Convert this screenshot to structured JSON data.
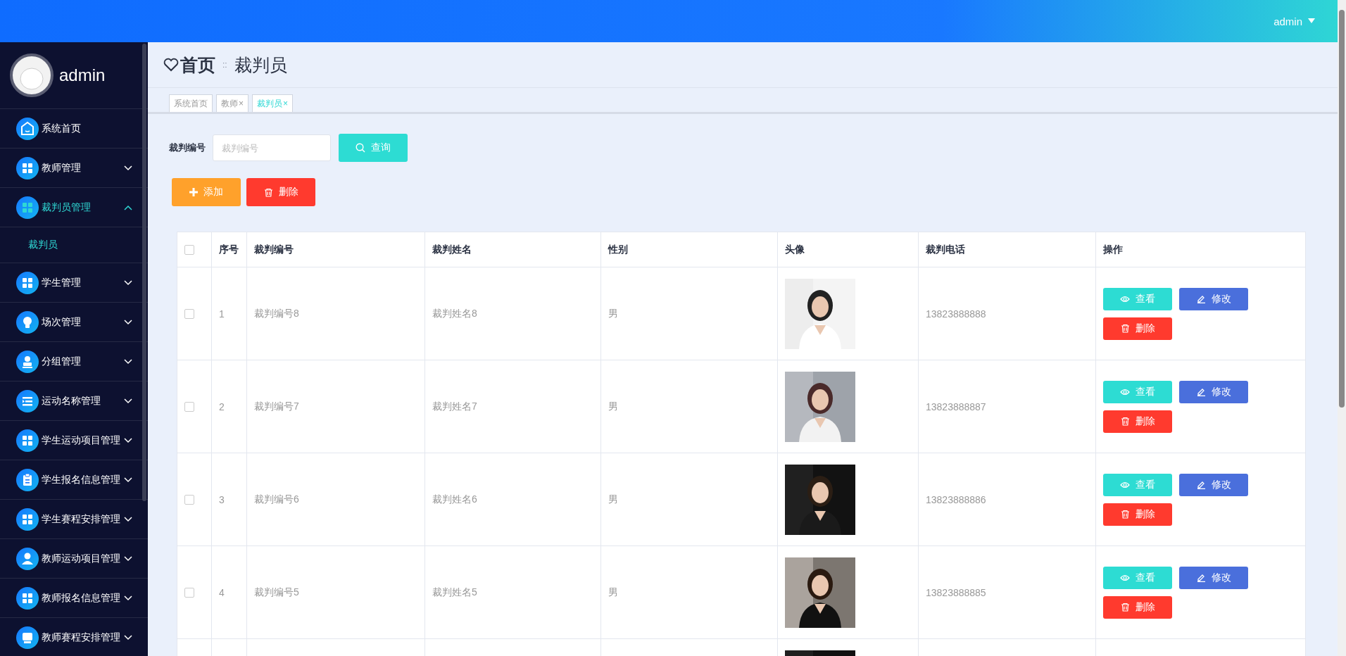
{
  "header": {
    "user": "admin"
  },
  "sidebar": {
    "user": "admin",
    "items": [
      {
        "label": "系统首页",
        "kind": "home",
        "selected": false
      },
      {
        "label": "教师管理",
        "kind": "grid",
        "expanded": false,
        "selected": false
      },
      {
        "label": "裁判员管理",
        "kind": "grid",
        "expanded": true,
        "selected": true,
        "children": [
          {
            "label": "裁判员",
            "selected": true
          }
        ]
      },
      {
        "label": "学生管理",
        "kind": "grid",
        "expanded": false,
        "selected": false
      },
      {
        "label": "场次管理",
        "kind": "bulb",
        "expanded": false,
        "selected": false
      },
      {
        "label": "分组管理",
        "kind": "stamp",
        "expanded": false,
        "selected": false
      },
      {
        "label": "运动名称管理",
        "kind": "list",
        "expanded": false,
        "selected": false
      },
      {
        "label": "学生运动项目管理",
        "kind": "grid",
        "expanded": false,
        "selected": false
      },
      {
        "label": "学生报名信息管理",
        "kind": "clipboard",
        "expanded": false,
        "selected": false
      },
      {
        "label": "学生赛程安排管理",
        "kind": "grid",
        "expanded": false,
        "selected": false
      },
      {
        "label": "教师运动项目管理",
        "kind": "person",
        "expanded": false,
        "selected": false
      },
      {
        "label": "教师报名信息管理",
        "kind": "grid",
        "expanded": false,
        "selected": false
      },
      {
        "label": "教师赛程安排管理",
        "kind": "tray",
        "expanded": false,
        "selected": false
      }
    ]
  },
  "breadcrumb": {
    "home": "首页",
    "separator": "::",
    "current": "裁判员"
  },
  "tabs": [
    {
      "label": "系统首页",
      "selected": false
    },
    {
      "label": "教师",
      "close": "×",
      "selected": false
    },
    {
      "label": "裁判员",
      "close": "×",
      "selected": true
    }
  ],
  "search": {
    "label": "裁判编号",
    "placeholder": "裁判编号",
    "button": "查询"
  },
  "actions": [
    {
      "kind": "add",
      "label": "添加"
    },
    {
      "kind": "delete",
      "label": "删除"
    }
  ],
  "table": {
    "all_checked": false,
    "columns": [
      "序号",
      "裁判编号",
      "裁判姓名",
      "性别",
      "头像",
      "裁判电话",
      "操作"
    ],
    "rows": [
      {
        "checked": false,
        "index": "1",
        "code": "裁判编号8",
        "name": "裁判姓名8",
        "gender": "男",
        "photo": {
          "kind": "picture"
        },
        "phone": "13823888888",
        "buttons": [
          {
            "kind": "view",
            "label": "查看"
          },
          {
            "kind": "edit",
            "label": "修改"
          },
          {
            "kind": "delete",
            "label": "删除"
          }
        ]
      },
      {
        "checked": false,
        "index": "2",
        "code": "裁判编号7",
        "name": "裁判姓名7",
        "gender": "男",
        "photo": {
          "kind": "picture"
        },
        "phone": "13823888887",
        "buttons": [
          {
            "kind": "view",
            "label": "查看"
          },
          {
            "kind": "edit",
            "label": "修改"
          },
          {
            "kind": "delete",
            "label": "删除"
          }
        ]
      },
      {
        "checked": false,
        "index": "3",
        "code": "裁判编号6",
        "name": "裁判姓名6",
        "gender": "男",
        "photo": {
          "kind": "picture"
        },
        "phone": "13823888886",
        "buttons": [
          {
            "kind": "view",
            "label": "查看"
          },
          {
            "kind": "edit",
            "label": "修改"
          },
          {
            "kind": "delete",
            "label": "删除"
          }
        ]
      },
      {
        "checked": false,
        "index": "4",
        "code": "裁判编号5",
        "name": "裁判姓名5",
        "gender": "男",
        "photo": {
          "kind": "picture"
        },
        "phone": "13823888885",
        "buttons": [
          {
            "kind": "view",
            "label": "查看"
          },
          {
            "kind": "edit",
            "label": "修改"
          },
          {
            "kind": "delete",
            "label": "删除"
          }
        ]
      },
      {
        "photo": {
          "kind": "picture"
        }
      }
    ]
  }
}
